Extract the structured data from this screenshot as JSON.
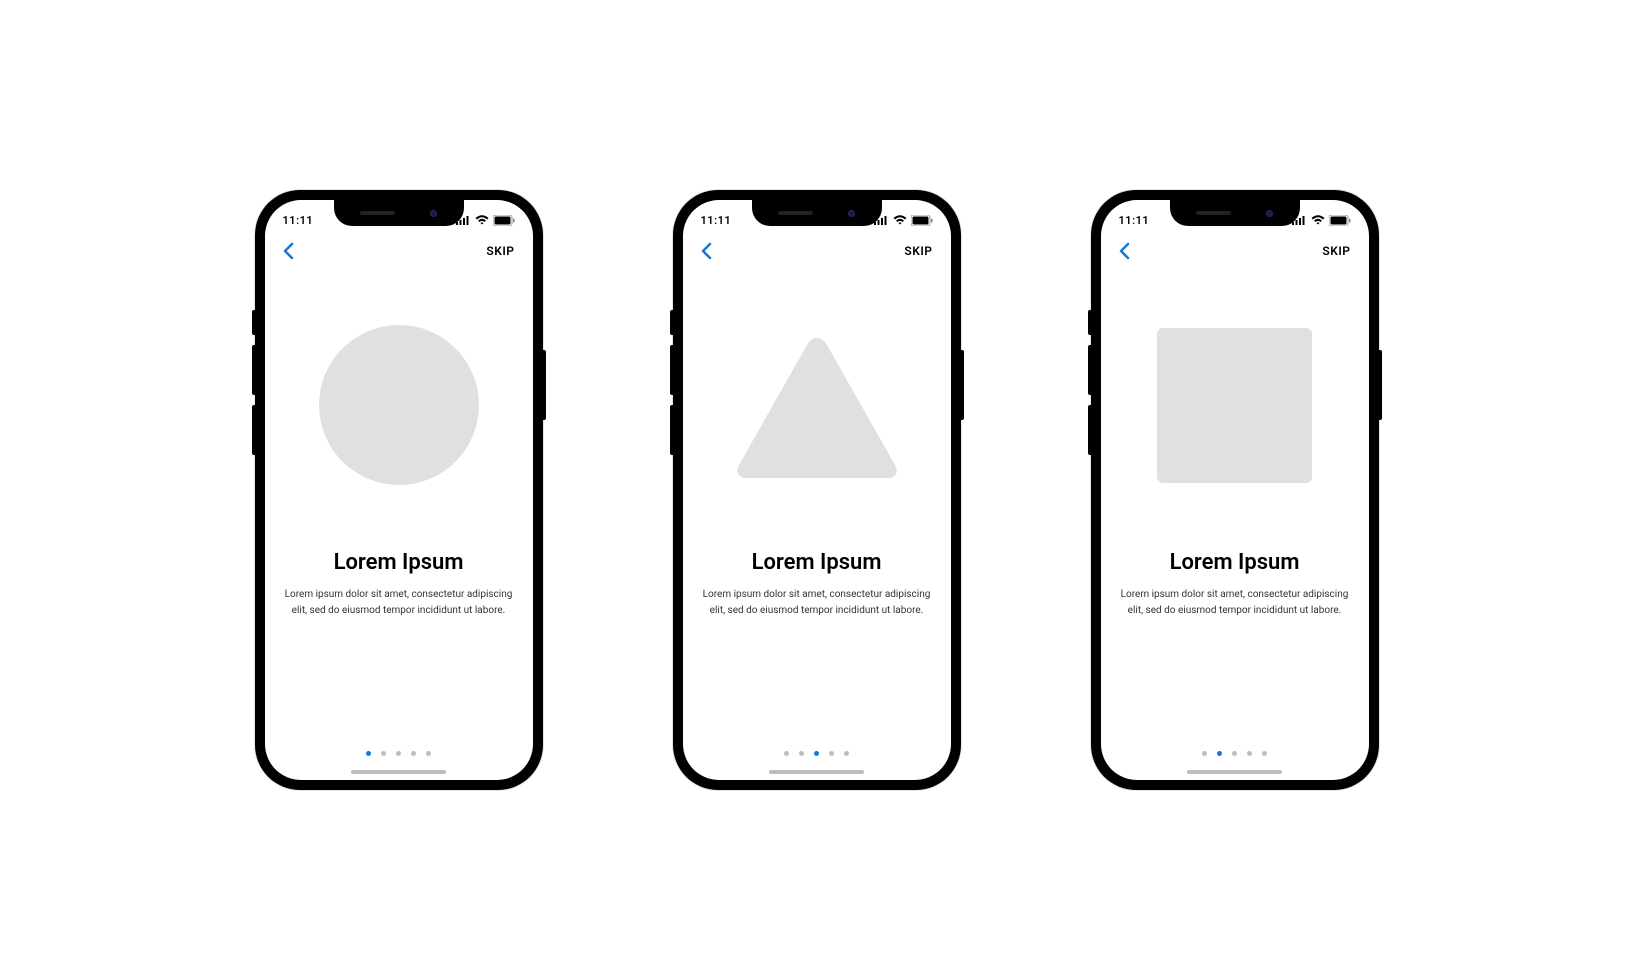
{
  "status": {
    "time": "11:11"
  },
  "nav": {
    "skip": "SKIP"
  },
  "screens": [
    {
      "shape": "circle",
      "title": "Lorem Ipsum",
      "description": "Lorem ipsum dolor sit amet, consectetur adipiscing elit, sed do eiusmod tempor incididunt ut labore.",
      "dots_total": 5,
      "active_dot": 0
    },
    {
      "shape": "triangle",
      "title": "Lorem Ipsum",
      "description": "Lorem ipsum dolor sit amet, consectetur adipiscing elit, sed do eiusmod tempor incididunt ut labore.",
      "dots_total": 5,
      "active_dot": 2
    },
    {
      "shape": "square",
      "title": "Lorem Ipsum",
      "description": "Lorem ipsum dolor sit amet, consectetur adipiscing elit, sed do eiusmod tempor incididunt ut labore.",
      "dots_total": 5,
      "active_dot": 1
    }
  ]
}
